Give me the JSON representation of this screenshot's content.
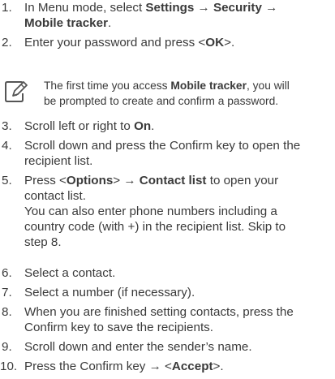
{
  "steps": [
    {
      "num": "1.",
      "parts": [
        [
          "In Menu mode, select ",
          false
        ],
        [
          "Settings → Security",
          true
        ],
        [
          " →",
          false
        ],
        [
          "|",
          false
        ],
        [
          "Mobile tracker",
          true
        ],
        [
          ".",
          false
        ]
      ]
    },
    {
      "num": "2.",
      "parts": [
        [
          "Enter your password and press <",
          false
        ],
        [
          "OK",
          true
        ],
        [
          ">.",
          false
        ]
      ]
    },
    {
      "num": "3.",
      "parts": [
        [
          "Scroll left or right to ",
          false
        ],
        [
          "On",
          true
        ],
        [
          ".",
          false
        ]
      ]
    },
    {
      "num": "4.",
      "parts": [
        [
          "Scroll down and press the Confirm key to open the",
          false
        ],
        [
          "|",
          false
        ],
        [
          "recipient list.",
          false
        ]
      ]
    },
    {
      "num": "5.",
      "parts": [
        [
          "Press <",
          false
        ],
        [
          "Options",
          true
        ],
        [
          "> → ",
          false
        ],
        [
          "Contact list",
          true
        ],
        [
          " to open your",
          false
        ],
        [
          "|",
          false
        ],
        [
          "contact list.",
          false
        ],
        [
          "|",
          false
        ],
        [
          "You can also enter phone numbers including a",
          false
        ],
        [
          "|",
          false
        ],
        [
          "country code (with +) in the recipient list. Skip to",
          false
        ],
        [
          "|",
          false
        ],
        [
          "step 8.",
          false
        ]
      ]
    },
    {
      "num": "6.",
      "parts": [
        [
          "Select a contact.",
          false
        ]
      ]
    },
    {
      "num": "7.",
      "parts": [
        [
          "Select a number (if necessary).",
          false
        ]
      ]
    },
    {
      "num": "8.",
      "parts": [
        [
          "When you are finished setting contacts, press the",
          false
        ],
        [
          "|",
          false
        ],
        [
          "Confirm key to save the recipients.",
          false
        ]
      ]
    },
    {
      "num": "9.",
      "parts": [
        [
          "Scroll down and enter the sender’s name.",
          false
        ]
      ]
    },
    {
      "num": "10.",
      "parts": [
        [
          "Press the Confirm key → <",
          false
        ],
        [
          "Accept",
          true
        ],
        [
          ">.",
          false
        ]
      ]
    }
  ],
  "note": {
    "icon": "note-pencil-icon",
    "parts": [
      [
        "The first time you access ",
        false
      ],
      [
        "Mobile tracker",
        true
      ],
      [
        ", you will",
        false
      ],
      [
        "|",
        false
      ],
      [
        "be prompted to create and confirm a password.",
        false
      ]
    ]
  }
}
